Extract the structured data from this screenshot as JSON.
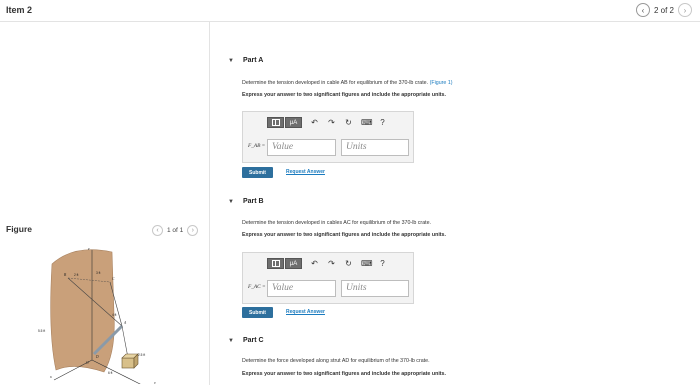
{
  "header": {
    "item_title": "Item 2",
    "pager_label": "2 of 2"
  },
  "figure_panel": {
    "title": "Figure",
    "pager_label": "1 of 1",
    "labels": {
      "z": "z",
      "y": "y",
      "x": "x",
      "dim_2ft": "2 ft",
      "dim_3ft": "3 ft",
      "dim_4ft": "4 ft",
      "dim_55ft": "5.5 ft",
      "dim_6ft": "6 ft",
      "dim_25ft": "2.5 ft",
      "pt_A": "A",
      "pt_B": "B",
      "pt_C": "C",
      "pt_D": "D",
      "pt_O": "O"
    }
  },
  "parts": [
    {
      "label": "Part A",
      "question": "Determine the tension developed in cable AB for equilibrium of the 370-lb crate.",
      "figure_link": "(Figure 1)",
      "instruction": "Express your answer to two significant figures and include the appropriate units.",
      "variable": "F_AB =",
      "value_placeholder": "Value",
      "units_placeholder": "Units",
      "submit_label": "Submit",
      "request_label": "Request Answer"
    },
    {
      "label": "Part B",
      "question": "Determine the tension developed in cables AC for equilibrium of the 370-lb crate.",
      "instruction": "Express your answer to two significant figures and include the appropriate units.",
      "variable": "F_AC =",
      "value_placeholder": "Value",
      "units_placeholder": "Units",
      "submit_label": "Submit",
      "request_label": "Request Answer"
    },
    {
      "label": "Part C",
      "question": "Determine the force developed along strut AD for equilibrium of the 370-lb crate.",
      "instruction": "Express your answer to two significant figures and include the appropriate units."
    }
  ],
  "toolbar": {
    "mu_label": "μA",
    "help_label": "?"
  }
}
